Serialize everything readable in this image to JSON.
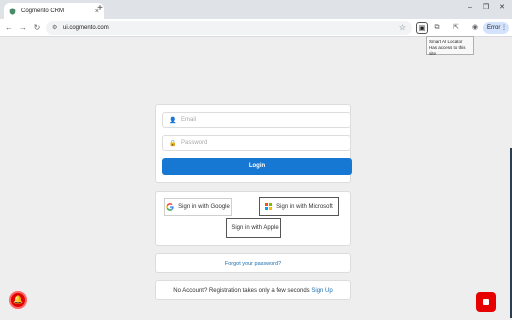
{
  "browser": {
    "tab_title": "Cogmento CRM",
    "tab_close": "×",
    "new_tab": "+",
    "url": "ui.cogmento.com",
    "profile_button": "Error",
    "extension_tooltip": {
      "line1": "Smart AI Locator",
      "line2": "Has access to this site"
    }
  },
  "form": {
    "email_placeholder": "Email",
    "password_placeholder": "Password",
    "login_label": "Login"
  },
  "social": {
    "google_label": "Sign in with Google",
    "microsoft_label": "Sign in with Microsoft",
    "apple_label": "Sign in with Apple"
  },
  "links": {
    "forgot_password": "Forgot your password?",
    "no_account_text": "No Account? Registration takes only a few seconds",
    "sign_up": "Sign Up"
  },
  "colors": {
    "login_button": "#1778d3",
    "link": "#1a6fb3",
    "alert_red": "#e00000"
  },
  "icons": [
    "shield-icon",
    "search-tune-icon",
    "star-icon",
    "bell-icon",
    "record-stop-icon",
    "google-icon",
    "microsoft-icon",
    "apple-icon",
    "user-icon",
    "lock-icon"
  ]
}
